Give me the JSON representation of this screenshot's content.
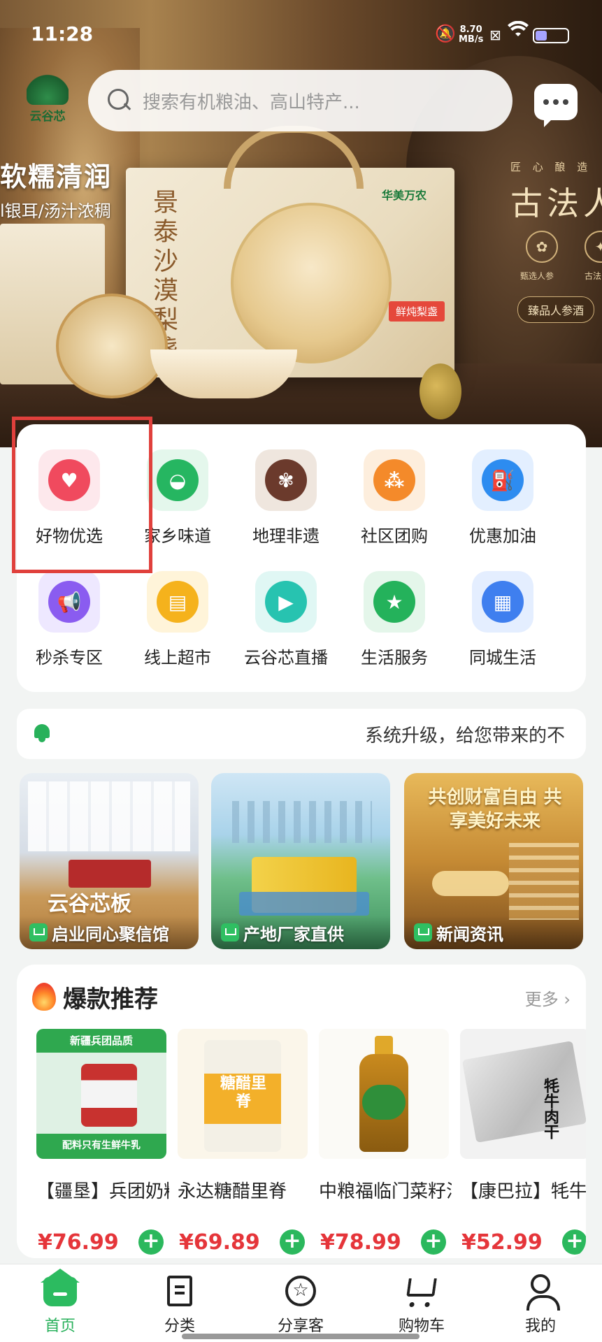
{
  "status_bar": {
    "time": "11:28",
    "net_speed": "8.70",
    "net_unit": "MB/s",
    "battery_level": 0.36
  },
  "header": {
    "logo_text": "云谷芯",
    "search_placeholder": "搜索有机粮油、高山特产..."
  },
  "banner": {
    "headline": "软糯清润",
    "subline": "l银耳/汤汁浓稠",
    "product_name": "景泰沙漠梨盏",
    "brand": "华美万农",
    "tag": "鲜炖梨盏",
    "right_top": "匠 心 酿 造",
    "right_title": "古法人",
    "right_badge_1": "甄选人参",
    "right_badge_2": "古法",
    "right_pill": "臻品人参酒"
  },
  "categories": [
    {
      "label": "好物优选",
      "icon": "heart-icon",
      "color": "#f04a5e",
      "bg": "#fde8ec"
    },
    {
      "label": "家乡味道",
      "icon": "rice-bowl-icon",
      "color": "#26b661",
      "bg": "#e4f7ec"
    },
    {
      "label": "地理非遗",
      "icon": "heritage-icon",
      "color": "#6b3a2c",
      "bg": "#efe6de"
    },
    {
      "label": "社区团购",
      "icon": "group-buy-icon",
      "color": "#f48a2a",
      "bg": "#fdeedd"
    },
    {
      "label": "优惠加油",
      "icon": "fuel-icon",
      "color": "#2d8cf0",
      "bg": "#e3efff"
    },
    {
      "label": "秒杀专区",
      "icon": "megaphone-icon",
      "color": "#8a5cf0",
      "bg": "#eee8ff"
    },
    {
      "label": "线上超市",
      "icon": "store-icon",
      "color": "#f5b21c",
      "bg": "#fff4d9"
    },
    {
      "label": "云谷芯直播",
      "icon": "live-video-icon",
      "color": "#27c3b0",
      "bg": "#e0f7f4"
    },
    {
      "label": "生活服务",
      "icon": "star-smile-icon",
      "color": "#24b25b",
      "bg": "#e4f6ea"
    },
    {
      "label": "同城生活",
      "icon": "grid-apps-icon",
      "color": "#3f7fef",
      "bg": "#e4eeff"
    }
  ],
  "notice": {
    "text": "系统升级，给您带来的不"
  },
  "promos": [
    {
      "label": "启业同心聚信馆",
      "big_text": "云谷芯板"
    },
    {
      "label": "产地厂家直供"
    },
    {
      "label": "新闻资讯",
      "gold_text": "共创财富自由 共享美好未来"
    }
  ],
  "hot": {
    "title": "爆款推荐",
    "more": "更多",
    "products": [
      {
        "name": "【疆垦】兵团奶粉",
        "price": "¥76.99",
        "img_top": "新疆兵团品质",
        "img_bottom": "配料只有生鲜牛乳"
      },
      {
        "name": "永达糖醋里脊",
        "price": "¥69.89",
        "img_top": "糖醋里脊"
      },
      {
        "name": "中粮福临门菜籽油",
        "price": "¥78.99"
      },
      {
        "name": "【康巴拉】牦牛肉干",
        "price": "¥52.99",
        "img_top": "牦牛肉干"
      }
    ]
  },
  "tabbar": [
    {
      "label": "首页",
      "active": true
    },
    {
      "label": "分类"
    },
    {
      "label": "分享客"
    },
    {
      "label": "购物车"
    },
    {
      "label": "我的"
    }
  ]
}
